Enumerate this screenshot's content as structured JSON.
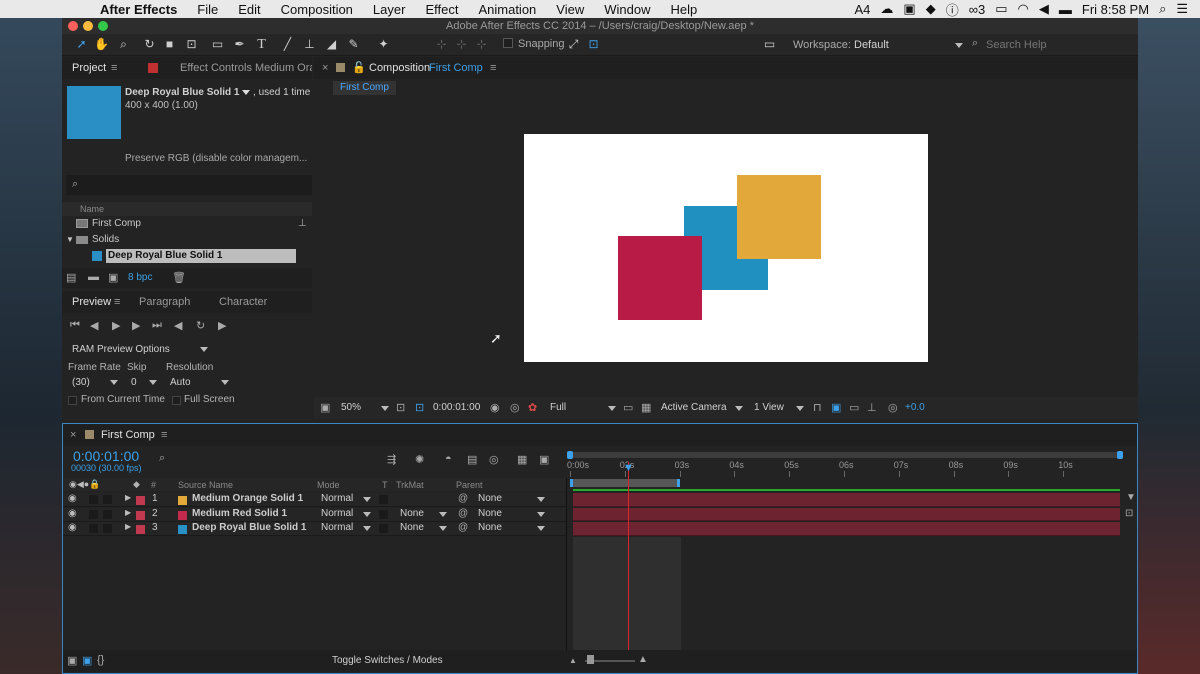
{
  "menubar": {
    "app_name": "After Effects",
    "items": [
      "File",
      "Edit",
      "Composition",
      "Layer",
      "Effect",
      "Animation",
      "View",
      "Window",
      "Help"
    ],
    "status_counts": [
      "4",
      "3"
    ],
    "clock": "Fri 8:58 PM"
  },
  "window": {
    "title": "Adobe After Effects CC 2014 – /Users/craig/Desktop/New.aep *"
  },
  "toolbar": {
    "snapping_label": "Snapping",
    "workspace_label": "Workspace:",
    "workspace_value": "Default",
    "search_placeholder": "Search Help"
  },
  "project": {
    "tab_label": "Project",
    "effect_controls_label": "Effect Controls Medium Orang",
    "item_name": "Deep Royal Blue Solid 1",
    "item_used": ", used 1 time",
    "item_dims": "400 x 400 (1.00)",
    "preserve_rgb": "Preserve RGB (disable color managem...",
    "col_name": "Name",
    "tree": [
      {
        "label": "First Comp",
        "type": "comp"
      },
      {
        "label": "Solids",
        "type": "folder"
      },
      {
        "label": "Deep Royal Blue Solid 1",
        "type": "solid",
        "color": "#2a8fc4",
        "selected": true
      }
    ],
    "bpc": "8 bpc"
  },
  "preview": {
    "tabs": [
      "Preview",
      "Paragraph",
      "Character"
    ],
    "ram_preview": "RAM Preview Options",
    "frame_rate_label": "Frame Rate",
    "skip_label": "Skip",
    "resolution_label": "Resolution",
    "frame_rate": "(30)",
    "skip": "0",
    "resolution": "Auto",
    "from_current": "From Current Time",
    "full_screen": "Full Screen"
  },
  "composition": {
    "tab_prefix": "Composition",
    "tab_name": "First Comp",
    "sub_tab": "First Comp",
    "zoom": "50%",
    "timecode": "0:00:01:00",
    "resolution": "Full",
    "camera": "Active Camera",
    "view": "1 View",
    "exposure": "+0.0",
    "canvas_bg": "#ffffff",
    "solids": {
      "blue": "#2090c0",
      "orange": "#e2a93a",
      "red": "#b81c46"
    }
  },
  "timeline": {
    "tab_name": "First Comp",
    "timecode": "0:00:01:00",
    "frame_info": "00030 (30.00 fps)",
    "col_source": "Source Name",
    "col_mode": "Mode",
    "col_t": "T",
    "col_trkmat": "TrkMat",
    "col_parent": "Parent",
    "col_num": "#",
    "layers": [
      {
        "num": "1",
        "name": "Medium Orange Solid 1",
        "color": "#e2a93a",
        "label_color": "#c0394f",
        "mode": "Normal",
        "trkmat": "",
        "parent": "None"
      },
      {
        "num": "2",
        "name": "Medium Red Solid 1",
        "color": "#c42a4e",
        "label_color": "#c0394f",
        "mode": "Normal",
        "trkmat": "None",
        "parent": "None"
      },
      {
        "num": "3",
        "name": "Deep Royal Blue Solid 1",
        "color": "#2a8fc4",
        "label_color": "#c0394f",
        "mode": "Normal",
        "trkmat": "None",
        "parent": "None"
      }
    ],
    "ruler": [
      "0:00s",
      "02s",
      "03s",
      "04s",
      "05s",
      "06s",
      "07s",
      "08s",
      "09s",
      "10s"
    ],
    "toggle_label": "Toggle Switches / Modes",
    "bar_color": "#6e2330"
  }
}
